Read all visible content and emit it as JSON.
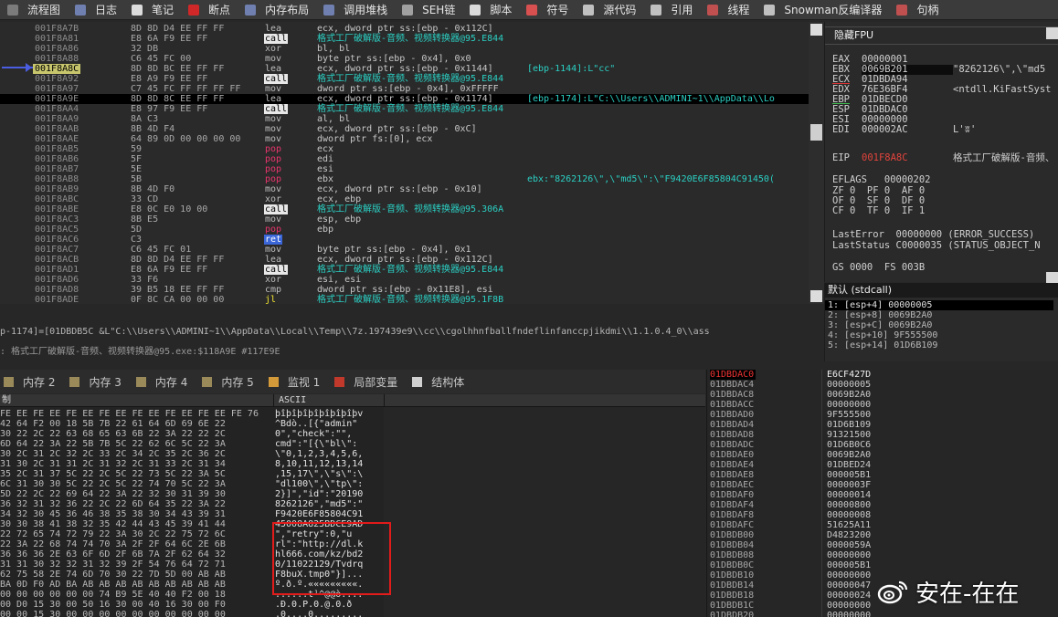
{
  "toolbar": {
    "items": [
      {
        "label": "流程图",
        "icon": "flow-graph-icon",
        "color": "#7b7b7b"
      },
      {
        "label": "日志",
        "icon": "log-icon",
        "color": "#6f7fb0"
      },
      {
        "label": "笔记",
        "icon": "notes-icon",
        "color": "#dcdcdc"
      },
      {
        "label": "断点",
        "icon": "breakpoint-icon",
        "color": "#d02828"
      },
      {
        "label": "内存布局",
        "icon": "memory-map-icon",
        "color": "#6f7fb0"
      },
      {
        "label": "调用堆栈",
        "icon": "call-stack-icon",
        "color": "#6f7fb0"
      },
      {
        "label": "SEH链",
        "icon": "seh-chain-icon",
        "color": "#a0a0a0"
      },
      {
        "label": "脚本",
        "icon": "script-icon",
        "color": "#dcdcdc"
      },
      {
        "label": "符号",
        "icon": "symbols-icon",
        "color": "#d85050"
      },
      {
        "label": "源代码",
        "icon": "source-icon",
        "color": "#c0c0c0"
      },
      {
        "label": "引用",
        "icon": "references-icon",
        "color": "#c0c0c0"
      },
      {
        "label": "线程",
        "icon": "threads-icon",
        "color": "#c05050"
      },
      {
        "label": "Snowman反编译器",
        "icon": "snowman-icon",
        "color": "#c0c0c0"
      },
      {
        "label": "句柄",
        "icon": "handles-icon",
        "color": "#c05050"
      }
    ]
  },
  "disasm": {
    "rows": [
      {
        "addr": "001F8A7B",
        "bytes": "8D 8D D4 EE FF FF",
        "mn": "lea",
        "ops": "ecx, dword ptr ss:[ebp - 0x112C]",
        "cmt": ""
      },
      {
        "addr": "001F8A81",
        "bytes": "E8 6A F9 EE FF",
        "mn": "call",
        "ops": "格式工厂破解版-音频、视频转换器@95.E844",
        "cmt": ""
      },
      {
        "addr": "001F8A86",
        "bytes": "32 DB",
        "mn": "xor",
        "ops": "bl, bl",
        "cmt": ""
      },
      {
        "addr": "001F8A88",
        "bytes": "C6 45 FC 00",
        "mn": "mov",
        "ops": "byte ptr ss:[ebp - 0x4], 0x0",
        "cmt": ""
      },
      {
        "addr": "001F8A8C",
        "bytes": "8D 8D BC EE FF FF",
        "mn": "lea",
        "ops": "ecx, dword ptr ss:[ebp - 0x1144]",
        "cmt": "[ebp-1144]:L\"cc\""
      },
      {
        "addr": "001F8A92",
        "bytes": "E8 A9 F9 EE FF",
        "mn": "call",
        "ops": "格式工厂破解版-音频、视频转换器@95.E844",
        "cmt": ""
      },
      {
        "addr": "001F8A97",
        "bytes": "C7 45 FC FF FF FF FF",
        "mn": "mov",
        "ops": "dword ptr ss:[ebp - 0x4], 0xFFFFF",
        "cmt": ""
      },
      {
        "addr": "001F8A9E",
        "bytes": "8D 8D 8C EE FF FF",
        "mn": "lea",
        "ops": "ecx, dword ptr ss:[ebp - 0x1174]",
        "cmt": "[ebp-1174]:L\"C:\\\\Users\\\\ADMINI~1\\\\AppData\\\\Lo"
      },
      {
        "addr": "001F8AA4",
        "bytes": "E8 97 F9 EE FF",
        "mn": "call",
        "ops": "格式工厂破解版-音频、视频转换器@95.E844",
        "cmt": ""
      },
      {
        "addr": "001F8AA9",
        "bytes": "8A C3",
        "mn": "mov",
        "ops": "al, bl",
        "cmt": ""
      },
      {
        "addr": "001F8AAB",
        "bytes": "8B 4D F4",
        "mn": "mov",
        "ops": "ecx, dword ptr ss:[ebp - 0xC]",
        "cmt": ""
      },
      {
        "addr": "001F8AAE",
        "bytes": "64 89 0D 00 00 00 00",
        "mn": "mov",
        "ops": "dword ptr fs:[0], ecx",
        "cmt": ""
      },
      {
        "addr": "001F8AB5",
        "bytes": "59",
        "mn": "pop",
        "ops": "ecx",
        "cmt": ""
      },
      {
        "addr": "001F8AB6",
        "bytes": "5F",
        "mn": "pop",
        "ops": "edi",
        "cmt": ""
      },
      {
        "addr": "001F8AB7",
        "bytes": "5E",
        "mn": "pop",
        "ops": "esi",
        "cmt": ""
      },
      {
        "addr": "001F8AB8",
        "bytes": "5B",
        "mn": "pop",
        "ops": "ebx",
        "cmt": "ebx:\"8262126\\\",\\\"md5\\\":\\\"F9420E6F85804C91450("
      },
      {
        "addr": "001F8AB9",
        "bytes": "8B 4D F0",
        "mn": "mov",
        "ops": "ecx, dword ptr ss:[ebp - 0x10]",
        "cmt": ""
      },
      {
        "addr": "001F8ABC",
        "bytes": "33 CD",
        "mn": "xor",
        "ops": "ecx, ebp",
        "cmt": ""
      },
      {
        "addr": "001F8ABE",
        "bytes": "E8 0C E0 10 00",
        "mn": "call",
        "ops": "格式工厂破解版-音频、视频转换器@95.306A",
        "cmt": ""
      },
      {
        "addr": "001F8AC3",
        "bytes": "8B E5",
        "mn": "mov",
        "ops": "esp, ebp",
        "cmt": ""
      },
      {
        "addr": "001F8AC5",
        "bytes": "5D",
        "mn": "pop",
        "ops": "ebp",
        "cmt": ""
      },
      {
        "addr": "001F8AC6",
        "bytes": "C3",
        "mn": "ret",
        "ops": "",
        "cmt": ""
      },
      {
        "addr": "001F8AC7",
        "bytes": "C6 45 FC 01",
        "mn": "mov",
        "ops": "byte ptr ss:[ebp - 0x4], 0x1",
        "cmt": ""
      },
      {
        "addr": "001F8ACB",
        "bytes": "8D 8D D4 EE FF FF",
        "mn": "lea",
        "ops": "ecx, dword ptr ss:[ebp - 0x112C]",
        "cmt": ""
      },
      {
        "addr": "001F8AD1",
        "bytes": "E8 6A F9 EE FF",
        "mn": "call",
        "ops": "格式工厂破解版-音频、视频转换器@95.E844",
        "cmt": ""
      },
      {
        "addr": "001F8AD6",
        "bytes": "33 F6",
        "mn": "xor",
        "ops": "esi, esi",
        "cmt": ""
      },
      {
        "addr": "001F8AD8",
        "bytes": "39 B5 18 EE FF FF",
        "mn": "cmp",
        "ops": "dword ptr ss:[ebp - 0x11E8], esi",
        "cmt": ""
      },
      {
        "addr": "001F8ADE",
        "bytes": "0F 8C CA 00 00 00",
        "mn": "jl",
        "ops": "格式工厂破解版-音频、视频转换器@95.1F8B",
        "cmt": ""
      }
    ]
  },
  "registers": {
    "title": "隐藏FPU",
    "rows": [
      {
        "name": "EAX",
        "val": "00000001",
        "cmt": ""
      },
      {
        "name": "EBX",
        "val": "0069B201",
        "cmt": "\"8262126\\\",\\\"md5",
        "box": true
      },
      {
        "name": "ECX",
        "val": "01DBDA94",
        "cmt": "",
        "u": "red"
      },
      {
        "name": "EDX",
        "val": "76E36BF4",
        "cmt": "<ntdll.KiFastSyst"
      },
      {
        "name": "EBP",
        "val": "01DBECD0",
        "cmt": "",
        "u": "grn"
      },
      {
        "name": "ESP",
        "val": "01DBDAC0",
        "cmt": ""
      },
      {
        "name": "ESI",
        "val": "00000000",
        "cmt": ""
      },
      {
        "name": "EDI",
        "val": "000002AC",
        "cmt": "L'ʬ'"
      }
    ],
    "eip": {
      "name": "EIP",
      "val": "001F8A8C",
      "cmt": "格式工厂破解版-音频、"
    },
    "eflags": "EFLAGS   00000202",
    "flags1": "ZF 0  PF 0  AF 0",
    "flags2": "OF 0  SF 0  DF 0",
    "flags3": "CF 0  TF 0  IF 1",
    "lasterror": "LastError  00000000 (ERROR_SUCCESS)",
    "laststatus": "LastStatus C0000035 (STATUS_OBJECT_N",
    "segs": "GS 0000  FS 003B"
  },
  "args": {
    "header": "默认 (stdcall)",
    "rows": [
      "1: [esp+4] 00000005",
      "2: [esp+8] 0069B2A0",
      "3: [esp+C] 0069B2A0",
      "4: [esp+10] 9F555500",
      "5: [esp+14] 01D6B109"
    ]
  },
  "info": {
    "line1": "p-1174]=[01DBDB5C &L\"C:\\\\Users\\\\ADMINI~1\\\\AppData\\\\Local\\\\Temp\\\\7z.197439e9\\\\cc\\\\cgolhhnfballfndeflinfanccpjikdmi\\\\1.1.0.4_0\\\\ass",
    "line2": ": 格式工厂破解版-音频、视频转换器@95.exe:$118A9E #117E9E"
  },
  "dumptabs": [
    {
      "label": "内存 2",
      "icon": "memory-icon"
    },
    {
      "label": "内存 3",
      "icon": "memory-icon"
    },
    {
      "label": "内存 4",
      "icon": "memory-icon"
    },
    {
      "label": "内存 5",
      "icon": "memory-icon"
    },
    {
      "label": "监视 1",
      "icon": "watch-icon"
    },
    {
      "label": "局部变量",
      "icon": "locals-icon"
    },
    {
      "label": "结构体",
      "icon": "struct-icon"
    }
  ],
  "dump": {
    "hex_header": "制",
    "ascii_header": "ASCII",
    "hex_rows": [
      "FE EE FE EE FE EE FE EE FE EE FE EE FE EE FE 76",
      "42 64 F2 00 18 5B 7B 22 61 64 6D 69 6E 22",
      "30 22 2C 22 63 68 65 63 6B 22 3A 22 22 2C",
      "6D 64 22 3A 22 5B 7B 5C 22 62 6C 5C 22 3A",
      "30 2C 31 2C 32 2C 33 2C 34 2C 35 2C 36 2C",
      "31 30 2C 31 31 2C 31 32 2C 31 33 2C 31 34",
      "35 2C 31 37 5C 22 2C 5C 22 73 5C 22 3A 5C",
      "6C 31 30 30 5C 22 2C 5C 22 74 70 5C 22 3A",
      "5D 22 2C 22 69 64 22 3A 22 32 30 31 39 30",
      "36 32 31 32 36 22 2C 22 6D 64 35 22 3A 22",
      "34 32 30 45 36 46 38 35 38 30 34 43 39 31",
      "30 30 38 41 38 32 35 42 44 43 45 39 41 44",
      "22 72 65 74 72 79 22 3A 30 2C 22 75 72 6C",
      "22 3A 22 68 74 74 70 3A 2F 2F 64 6C 2E 6B",
      "36 36 36 2E 63 6F 6D 2F 6B 7A 2F 62 64 32",
      "31 31 30 32 32 31 32 39 2F 54 76 64 72 71",
      "62 75 58 2E 74 6D 70 30 22 7D 5D 00 AB AB",
      "BA 0D F0 AD BA AB AB AB AB AB AB AB AB AB",
      "00 00 00 00 00 00 74 B9 5E 40 40 F2 00 18",
      "00 D0 15 30 00 50 16 30 00 40 16 30 00 F0",
      "00 00 15 30 00 00 00 00 00 00 00 00 00 00"
    ],
    "ascii_rows": [
      "þîþîþîþîþîþîþîþv",
      "^Bdò..[{\"admin\"",
      "0\",\"check\":\"\",",
      "cmd\":\"[{\\\"bl\\\":",
      "\\\"0,1,2,3,4,5,6,",
      "8,10,11,12,13,14",
      ",15,17\\\",\\\"s\\\":\\",
      "\"dl100\\\",\\\"tp\\\":",
      "2}]\",\"id\":\"20190",
      "8262126\",\"md5\":\"",
      "F9420E6F85804C91",
      "45008A825BDCE9AD",
      "\",\"retry\":0,\"u",
      "rl\":\"http://dl.k",
      "hl666.com/kz/bd2",
      "0/11022129/Tvdrq",
      "F8buX.tmp0\"}]...",
      "º.ð.º.«««««««««.",
      "......t¹^@@ò....",
      ".Ð.0.P.0.@.0.ð",
      ".0....0........."
    ]
  },
  "stack": {
    "rows": [
      {
        "addr": "01DBDAC0",
        "val": "E6CF427D"
      },
      {
        "addr": "01DBDAC4",
        "val": "00000005"
      },
      {
        "addr": "01DBDAC8",
        "val": "0069B2A0"
      },
      {
        "addr": "01DBDACC",
        "val": "00000000"
      },
      {
        "addr": "01DBDAD0",
        "val": "9F555500"
      },
      {
        "addr": "01DBDAD4",
        "val": "01D6B109"
      },
      {
        "addr": "01DBDAD8",
        "val": "91321500"
      },
      {
        "addr": "01DBDADC",
        "val": "01D6B0C6"
      },
      {
        "addr": "01DBDAE0",
        "val": "0069B2A0"
      },
      {
        "addr": "01DBDAE4",
        "val": "01DBED24"
      },
      {
        "addr": "01DBDAE8",
        "val": "000005B1"
      },
      {
        "addr": "01DBDAEC",
        "val": "0000003F"
      },
      {
        "addr": "01DBDAF0",
        "val": "00000014"
      },
      {
        "addr": "01DBDAF4",
        "val": "00000800"
      },
      {
        "addr": "01DBDAF8",
        "val": "00000008"
      },
      {
        "addr": "01DBDAFC",
        "val": "51625A11"
      },
      {
        "addr": "01DBDB00",
        "val": "D4823200"
      },
      {
        "addr": "01DBDB04",
        "val": "0000059A"
      },
      {
        "addr": "01DBDB08",
        "val": "00000000"
      },
      {
        "addr": "01DBDB0C",
        "val": "000005B1"
      },
      {
        "addr": "01DBDB10",
        "val": "00000000"
      },
      {
        "addr": "01DBDB14",
        "val": "00000047"
      },
      {
        "addr": "01DBDB18",
        "val": "00000024"
      },
      {
        "addr": "01DBDB1C",
        "val": "00000000"
      },
      {
        "addr": "01DBDB20",
        "val": "00000000"
      }
    ]
  },
  "watermark": {
    "text": "安在-在在"
  }
}
